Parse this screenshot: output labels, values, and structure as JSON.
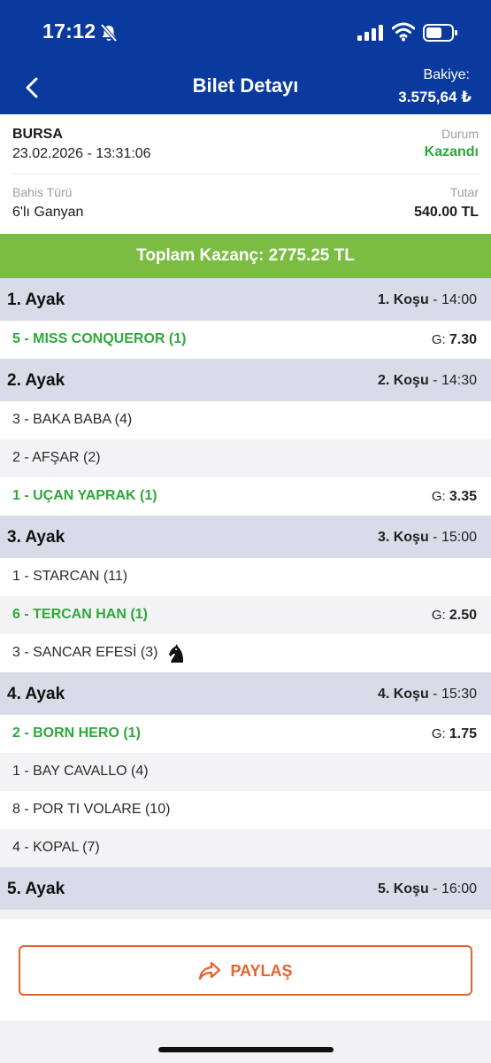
{
  "status_bar": {
    "time": "17:12"
  },
  "nav": {
    "title": "Bilet Detayı",
    "balance_label": "Bakiye:",
    "balance_value": "3.575,64 ₺"
  },
  "ticket": {
    "city": "BURSA",
    "datetime": "23.02.2026 - 13:31:06",
    "status_label": "Durum",
    "status_value": "Kazandı",
    "bet_type_label": "Bahis Türü",
    "bet_type_value": "6'lı Ganyan",
    "amount_label": "Tutar",
    "amount_value": "540.00 TL"
  },
  "total": {
    "text": "Toplam Kazanç: 2775.25 TL"
  },
  "odds_prefix": "G:",
  "legs": [
    {
      "title": "1. Ayak",
      "race": "1. Koşu",
      "time": " - 14:00",
      "horses": [
        {
          "name": "5 - MISS CONQUEROR (1)",
          "winner": true,
          "odds": "7.30"
        }
      ]
    },
    {
      "title": "2. Ayak",
      "race": "2. Koşu",
      "time": " - 14:30",
      "horses": [
        {
          "name": "3 - BAKA BABA (4)",
          "winner": false
        },
        {
          "name": "2 - AFŞAR (2)",
          "winner": false
        },
        {
          "name": "1 - UÇAN YAPRAK (1)",
          "winner": true,
          "odds": "3.35"
        }
      ]
    },
    {
      "title": "3. Ayak",
      "race": "3. Koşu",
      "time": " - 15:00",
      "horses": [
        {
          "name": "1 - STARCAN (11)",
          "winner": false
        },
        {
          "name": "6 - TERCAN HAN (1)",
          "winner": true,
          "odds": "2.50"
        },
        {
          "name": "3 - SANCAR EFESİ (3)",
          "winner": false,
          "icon": "knight-icon"
        }
      ]
    },
    {
      "title": "4. Ayak",
      "race": "4. Koşu",
      "time": " - 15:30",
      "horses": [
        {
          "name": "2 - BORN HERO (1)",
          "winner": true,
          "odds": "1.75"
        },
        {
          "name": "1 - BAY CAVALLO (4)",
          "winner": false
        },
        {
          "name": "8 - POR TI VOLARE (10)",
          "winner": false
        },
        {
          "name": "4 - KOPAL (7)",
          "winner": false
        }
      ]
    },
    {
      "title": "5. Ayak",
      "race": "5. Koşu",
      "time": " - 16:00",
      "horses": []
    }
  ],
  "footer": {
    "share_label": "PAYLAŞ"
  },
  "colors": {
    "header_blue": "#0b3a9e",
    "win_green": "#2ea83a",
    "total_green": "#7bbd42",
    "share_orange": "#e8622c"
  }
}
